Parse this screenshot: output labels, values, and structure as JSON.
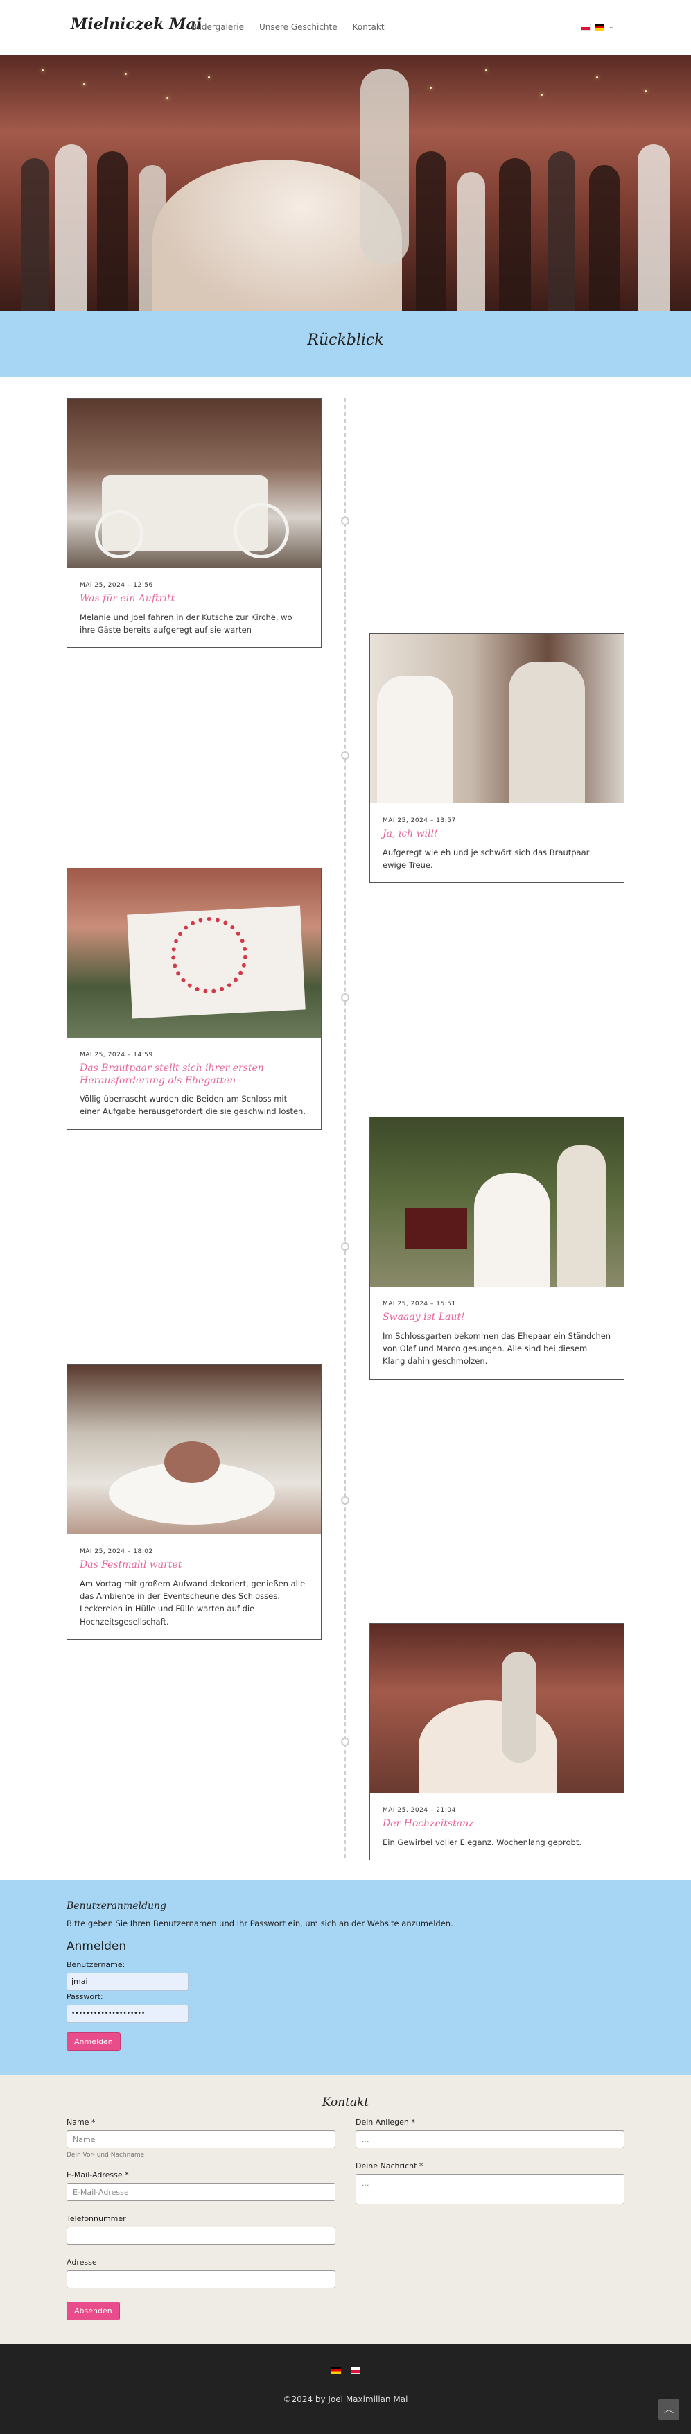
{
  "header": {
    "logo": "Mielniczek Mai",
    "nav": [
      "Bildergalerie",
      "Unsere Geschichte",
      "Kontakt"
    ]
  },
  "section": {
    "title": "Rückblick"
  },
  "timeline": [
    {
      "date": "MAI 25, 2024 – 12:56",
      "title": "Was für ein Auftritt",
      "desc": "Melanie und Joel fahren in der Kutsche zur Kirche, wo ihre Gäste bereits aufgeregt auf sie warten"
    },
    {
      "date": "MAI 25, 2024 – 13:57",
      "title": "Ja, ich will!",
      "desc": "Aufgeregt wie eh und je schwört sich das Brautpaar ewige Treue."
    },
    {
      "date": "MAI 25, 2024 – 14:59",
      "title": "Das Brautpaar stellt sich ihrer ersten Herausforderung als Ehegatten",
      "desc": "Völlig überrascht wurden die Beiden am Schloss mit einer Aufgabe herausgefordert die sie geschwind lösten."
    },
    {
      "date": "MAI 25, 2024 – 15:51",
      "title": "Swaaay ist Laut!",
      "desc": "Im Schlossgarten bekommen das Ehepaar ein Ständchen von Olaf und Marco gesungen. Alle sind bei diesem Klang dahin geschmolzen."
    },
    {
      "date": "MAI 25, 2024 – 18:02",
      "title": "Das Festmahl wartet",
      "desc": "Am Vortag mit großem Aufwand dekoriert, genießen alle das Ambiente in der Eventscheune des Schlosses. Leckereien in Hülle und Fülle warten auf die Hochzeitsgesellschaft."
    },
    {
      "date": "MAI 25, 2024 – 21:04",
      "title": "Der Hochzeitstanz",
      "desc": "Ein Gewirbel voller Eleganz. Wochenlang geprobt."
    }
  ],
  "login": {
    "heading": "Benutzeranmeldung",
    "intro": "Bitte geben Sie Ihren Benutzernamen und Ihr Passwort ein, um sich an der Website anzumelden.",
    "title": "Anmelden",
    "username_label": "Benutzername:",
    "username_value": "jmai",
    "password_label": "Passwort:",
    "password_value": "••••••••••••••••••••",
    "button": "Anmelden"
  },
  "contact": {
    "heading": "Kontakt",
    "name_label": "Name *",
    "name_placeholder": "Name",
    "name_hint": "Dein Vor- und Nachname",
    "email_label": "E-Mail-Adresse *",
    "email_placeholder": "E-Mail-Adresse",
    "phone_label": "Telefonnummer",
    "address_label": "Adresse",
    "concern_label": "Dein Anliegen *",
    "concern_placeholder": "...",
    "message_label": "Deine Nachricht *",
    "message_placeholder": "...",
    "button": "Absenden"
  },
  "footer": {
    "copyright": "©2024 by Joel Maximilian Mai"
  },
  "colors": {
    "accent": "#e84c8b",
    "section_bg": "#a7d6f4",
    "contact_bg": "#efece6",
    "footer_bg": "#222222"
  }
}
